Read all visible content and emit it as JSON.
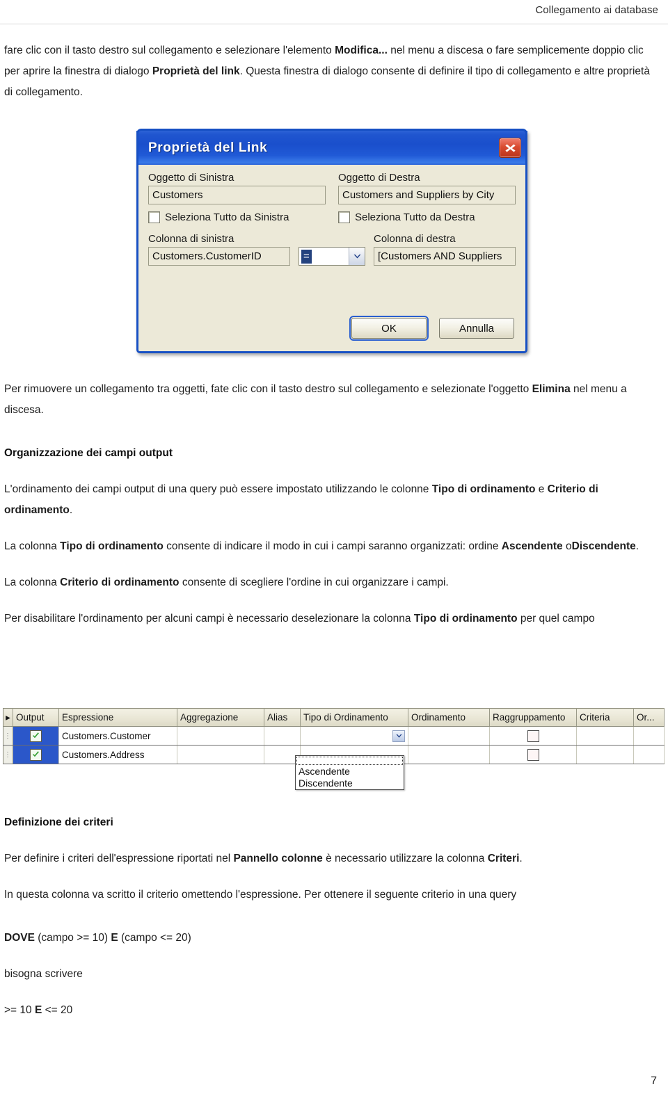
{
  "header": {
    "running_title": "Collegamento ai database"
  },
  "body_top": {
    "p1_part1": "fare clic con il tasto destro sul collegamento e selezionare l'elemento ",
    "p1_bold1": "Modifica...",
    "p1_part2": " nel menu a discesa o fare semplicemente doppio clic per aprire la finestra di dialogo ",
    "p1_bold2": "Proprietà del link",
    "p1_part3": ". Questa finestra di dialogo consente di definire il tipo di collegamento e altre proprietà di collegamento."
  },
  "dialog": {
    "title": "Proprietà del Link",
    "close_icon": "close-icon",
    "left_object_label": "Oggetto di Sinistra",
    "left_object_value": "Customers",
    "right_object_label": "Oggetto di Destra",
    "right_object_value": "Customers and Suppliers by City",
    "left_checkbox_label": "Seleziona Tutto da Sinistra",
    "right_checkbox_label": "Seleziona Tutto da Destra",
    "left_column_label": "Colonna di sinistra",
    "left_column_value": "Customers.CustomerID",
    "operator_value": "=",
    "right_column_label": "Colonna di destra",
    "right_column_value": "[Customers AND Suppliers",
    "ok_label": "OK",
    "cancel_label": "Annulla"
  },
  "body_mid": {
    "p2_part1": "Per rimuovere un collegamento tra oggetti, fate clic con il tasto destro sul collegamento e selezionate l'oggetto ",
    "p2_bold1": "Elimina",
    "p2_part2": " nel menu a discesa.",
    "h1": "Organizzazione dei campi output",
    "p3_part1": "L'ordinamento dei campi output di una query può essere impostato utilizzando le colonne ",
    "p3_bold1": "Tipo di ordinamento",
    "p3_part2": " e ",
    "p3_bold2": "Criterio di ordinamento",
    "p3_part3": ".",
    "p4_part1": "La colonna ",
    "p4_bold1": "Tipo di ordinamento",
    "p4_part2": " consente di indicare il modo in cui i campi saranno organizzati: ordine ",
    "p4_bold2": "Ascendente",
    "p4_part3": " o",
    "p4_bold3": "Discendente",
    "p4_part4": ".",
    "p5_part1": "La colonna ",
    "p5_bold1": "Criterio di ordinamento",
    "p5_part2": " consente di scegliere l'ordine in cui organizzare i campi.",
    "p6_part1": "Per disabilitare l'ordinamento per alcuni campi è necessario deselezionare la colonna ",
    "p6_bold1": "Tipo di ordinamento",
    "p6_part2": " per quel campo"
  },
  "grid": {
    "columns": [
      "Output",
      "Espressione",
      "Aggregazione",
      "Alias",
      "Tipo di Ordinamento",
      "Ordinamento",
      "Raggruppamento",
      "Criteria",
      "Or..."
    ],
    "rows": [
      {
        "output_checked": true,
        "espressione": "Customers.Customer",
        "aggregazione": "",
        "alias": "",
        "tipo_ordinamento": "",
        "ordinamento": "",
        "raggruppamento_checked": false,
        "criteria": "",
        "or": ""
      },
      {
        "output_checked": true,
        "espressione": "Customers.Address",
        "aggregazione": "",
        "alias": "",
        "tipo_ordinamento": "",
        "ordinamento": "",
        "raggruppamento_checked": false,
        "criteria": "",
        "or": ""
      }
    ],
    "dropdown_options": [
      "",
      "Ascendente",
      "Discendente"
    ],
    "selected_row_color": "#2b57c9",
    "check_color": "#2f9e2f"
  },
  "body_bottom": {
    "h2": "Definizione dei criteri",
    "p7_part1": "Per definire i criteri dell'espressione riportati nel ",
    "p7_bold1": "Pannello colonne",
    "p7_part2": " è necessario utilizzare la colonna ",
    "p7_bold2": "Criteri",
    "p7_part3": ".",
    "p8": "In questa colonna va scritto il criterio omettendo l'espressione. Per ottenere il seguente criterio in una query",
    "p9_bold1": "DOVE",
    "p9_part1": " (campo >= 10) ",
    "p9_bold2": "E",
    "p9_part2": " (campo <= 20)",
    "p10": "bisogna scrivere",
    "p11_part1": ">= 10 ",
    "p11_bold1": "E",
    "p11_part2": " <= 20"
  },
  "footer": {
    "page_number": "7"
  }
}
